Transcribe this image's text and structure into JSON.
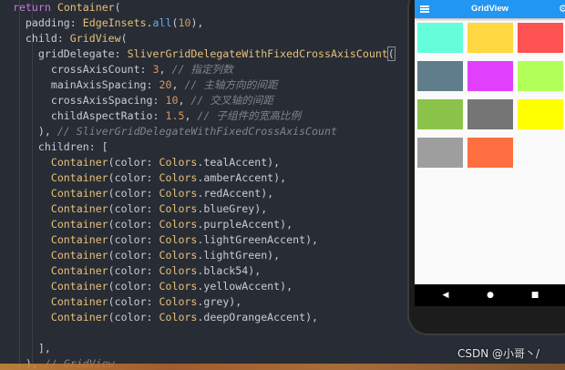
{
  "code": {
    "lines": [
      [
        {
          "t": "  ",
          "c": "pl"
        },
        {
          "t": "return",
          "c": "kw"
        },
        {
          "t": " ",
          "c": "pl"
        },
        {
          "t": "Container",
          "c": "cls"
        },
        {
          "t": "(",
          "c": "pl"
        }
      ],
      [
        {
          "t": "    padding: ",
          "c": "pl"
        },
        {
          "t": "EdgeInsets",
          "c": "cls"
        },
        {
          "t": ".",
          "c": "pl"
        },
        {
          "t": "all",
          "c": "fn"
        },
        {
          "t": "(",
          "c": "pl"
        },
        {
          "t": "10",
          "c": "num"
        },
        {
          "t": "),",
          "c": "pl"
        }
      ],
      [
        {
          "t": "    child: ",
          "c": "pl"
        },
        {
          "t": "GridView",
          "c": "cls"
        },
        {
          "t": "(",
          "c": "pl"
        }
      ],
      [
        {
          "t": "      gridDelegate: ",
          "c": "pl"
        },
        {
          "t": "SliverGridDelegateWithFixedCrossAxisCount",
          "c": "cls"
        },
        {
          "t": "(",
          "c": "pl"
        }
      ],
      [
        {
          "t": "        crossAxisCount: ",
          "c": "pl"
        },
        {
          "t": "3",
          "c": "num"
        },
        {
          "t": ", ",
          "c": "pl"
        },
        {
          "t": "// 指定列数",
          "c": "cm"
        }
      ],
      [
        {
          "t": "        mainAxisSpacing: ",
          "c": "pl"
        },
        {
          "t": "20",
          "c": "num"
        },
        {
          "t": ", ",
          "c": "pl"
        },
        {
          "t": "// 主轴方向的间距",
          "c": "cm"
        }
      ],
      [
        {
          "t": "        crossAxisSpacing: ",
          "c": "pl"
        },
        {
          "t": "10",
          "c": "num"
        },
        {
          "t": ", ",
          "c": "pl"
        },
        {
          "t": "// 交叉轴的间距",
          "c": "cm"
        }
      ],
      [
        {
          "t": "        childAspectRatio: ",
          "c": "pl"
        },
        {
          "t": "1.5",
          "c": "num"
        },
        {
          "t": ", ",
          "c": "pl"
        },
        {
          "t": "// 子组件的宽高比例",
          "c": "cm"
        }
      ],
      [
        {
          "t": "      ), ",
          "c": "pl"
        },
        {
          "t": "// SliverGridDelegateWithFixedCrossAxisCount",
          "c": "cm"
        }
      ],
      [
        {
          "t": "      children: [",
          "c": "pl"
        }
      ],
      [
        {
          "t": "        ",
          "c": "pl"
        },
        {
          "t": "Container",
          "c": "cls"
        },
        {
          "t": "(color: ",
          "c": "pl"
        },
        {
          "t": "Colors",
          "c": "cls"
        },
        {
          "t": ".tealAccent),",
          "c": "pl"
        }
      ],
      [
        {
          "t": "        ",
          "c": "pl"
        },
        {
          "t": "Container",
          "c": "cls"
        },
        {
          "t": "(color: ",
          "c": "pl"
        },
        {
          "t": "Colors",
          "c": "cls"
        },
        {
          "t": ".amberAccent),",
          "c": "pl"
        }
      ],
      [
        {
          "t": "        ",
          "c": "pl"
        },
        {
          "t": "Container",
          "c": "cls"
        },
        {
          "t": "(color: ",
          "c": "pl"
        },
        {
          "t": "Colors",
          "c": "cls"
        },
        {
          "t": ".redAccent),",
          "c": "pl"
        }
      ],
      [
        {
          "t": "        ",
          "c": "pl"
        },
        {
          "t": "Container",
          "c": "cls"
        },
        {
          "t": "(color: ",
          "c": "pl"
        },
        {
          "t": "Colors",
          "c": "cls"
        },
        {
          "t": ".blueGrey),",
          "c": "pl"
        }
      ],
      [
        {
          "t": "        ",
          "c": "pl"
        },
        {
          "t": "Container",
          "c": "cls"
        },
        {
          "t": "(color: ",
          "c": "pl"
        },
        {
          "t": "Colors",
          "c": "cls"
        },
        {
          "t": ".purpleAccent),",
          "c": "pl"
        }
      ],
      [
        {
          "t": "        ",
          "c": "pl"
        },
        {
          "t": "Container",
          "c": "cls"
        },
        {
          "t": "(color: ",
          "c": "pl"
        },
        {
          "t": "Colors",
          "c": "cls"
        },
        {
          "t": ".lightGreenAccent),",
          "c": "pl"
        }
      ],
      [
        {
          "t": "        ",
          "c": "pl"
        },
        {
          "t": "Container",
          "c": "cls"
        },
        {
          "t": "(color: ",
          "c": "pl"
        },
        {
          "t": "Colors",
          "c": "cls"
        },
        {
          "t": ".lightGreen),",
          "c": "pl"
        }
      ],
      [
        {
          "t": "        ",
          "c": "pl"
        },
        {
          "t": "Container",
          "c": "cls"
        },
        {
          "t": "(color: ",
          "c": "pl"
        },
        {
          "t": "Colors",
          "c": "cls"
        },
        {
          "t": ".black54),",
          "c": "pl"
        }
      ],
      [
        {
          "t": "        ",
          "c": "pl"
        },
        {
          "t": "Container",
          "c": "cls"
        },
        {
          "t": "(color: ",
          "c": "pl"
        },
        {
          "t": "Colors",
          "c": "cls"
        },
        {
          "t": ".yellowAccent),",
          "c": "pl"
        }
      ],
      [
        {
          "t": "        ",
          "c": "pl"
        },
        {
          "t": "Container",
          "c": "cls"
        },
        {
          "t": "(color: ",
          "c": "pl"
        },
        {
          "t": "Colors",
          "c": "cls"
        },
        {
          "t": ".grey),",
          "c": "pl"
        }
      ],
      [
        {
          "t": "        ",
          "c": "pl"
        },
        {
          "t": "Container",
          "c": "cls"
        },
        {
          "t": "(color: ",
          "c": "pl"
        },
        {
          "t": "Colors",
          "c": "cls"
        },
        {
          "t": ".deepOrangeAccent),",
          "c": "pl"
        }
      ],
      [
        {
          "t": "",
          "c": "pl"
        }
      ],
      [
        {
          "t": "      ],",
          "c": "pl"
        }
      ],
      [
        {
          "t": "    ), ",
          "c": "pl"
        },
        {
          "t": "// GridView",
          "c": "cm"
        }
      ]
    ]
  },
  "phone": {
    "app_title": "GridView",
    "menu_icon": "menu-icon",
    "settings_icon": "gear-icon",
    "tiles": [
      {
        "color": "#64ffda"
      },
      {
        "color": "#ffd740"
      },
      {
        "color": "#ff5252"
      },
      {
        "color": "#607d8b"
      },
      {
        "color": "#e040fb"
      },
      {
        "color": "#b2ff59"
      },
      {
        "color": "#8bc34a"
      },
      {
        "color": "#757575"
      },
      {
        "color": "#ffff00"
      },
      {
        "color": "#9e9e9e"
      },
      {
        "color": "#ff6e40"
      }
    ],
    "nav": {
      "back": "◀",
      "home": "●",
      "recents": "■"
    }
  },
  "watermark": "CSDN @小哥丶/"
}
